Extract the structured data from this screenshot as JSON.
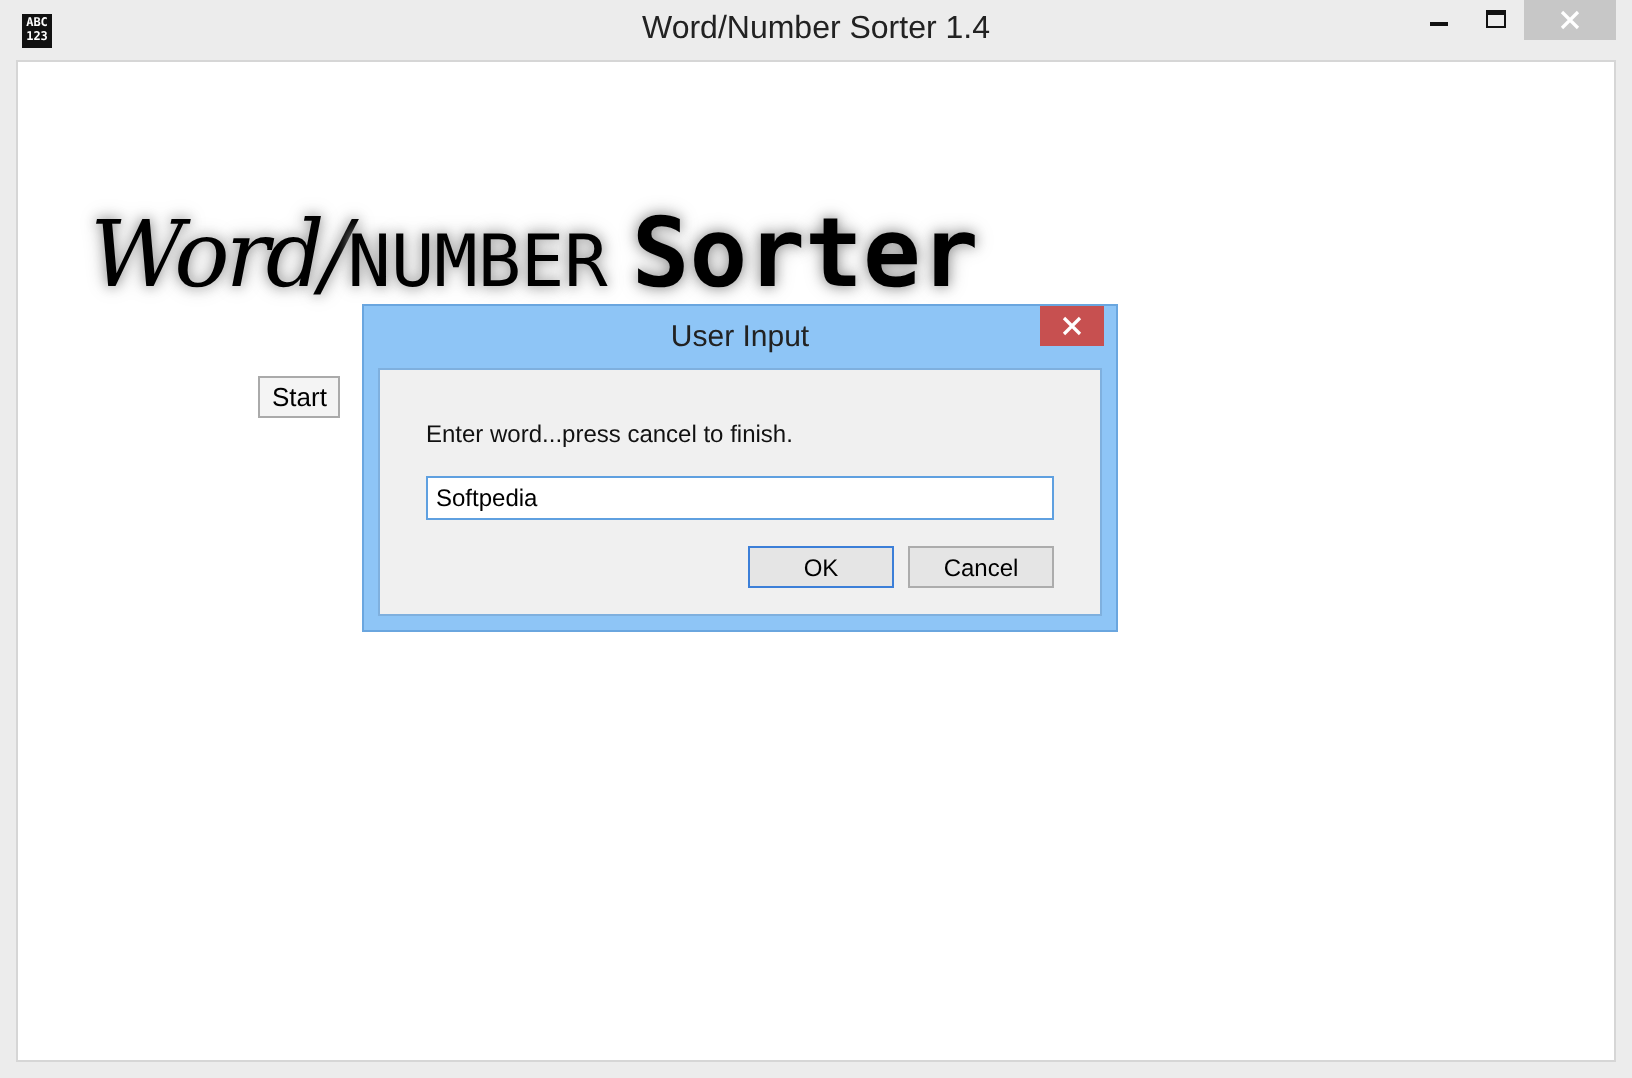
{
  "window": {
    "title": "Word/Number Sorter 1.4",
    "icon_lines": [
      "ABC",
      "123"
    ]
  },
  "logo": [
    {
      "text": "Word/",
      "kind": "script"
    },
    {
      "text": "NUMBER",
      "kind": "digital"
    },
    {
      "text": "Sorter",
      "kind": "bold"
    }
  ],
  "start_button": "Start",
  "dialog": {
    "title": "User Input",
    "prompt": "Enter word...press cancel to finish.",
    "input": {
      "value": "Softpedia"
    },
    "buttons": [
      {
        "label": "OK",
        "selected": true
      },
      {
        "label": "Cancel",
        "selected": false
      }
    ]
  }
}
